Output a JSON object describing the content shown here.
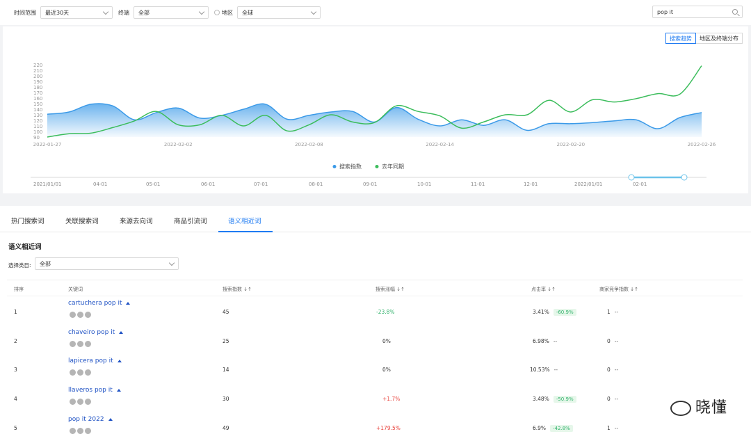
{
  "filters": {
    "time_label": "时间范围",
    "time_value": "最近30天",
    "terminal_label": "终端",
    "terminal_value": "全部",
    "region_label": "地区",
    "region_value": "全球",
    "search_value": "pop it"
  },
  "chart_toggle": {
    "active": "搜索趋势",
    "inactive": "地区及终端分布"
  },
  "chart_data": {
    "type": "area",
    "x": [
      "2022-01-27",
      "2022-01-28",
      "2022-01-29",
      "2022-01-30",
      "2022-01-31",
      "2022-02-01",
      "2022-02-02",
      "2022-02-03",
      "2022-02-04",
      "2022-02-05",
      "2022-02-06",
      "2022-02-07",
      "2022-02-08",
      "2022-02-09",
      "2022-02-10",
      "2022-02-11",
      "2022-02-12",
      "2022-02-13",
      "2022-02-14",
      "2022-02-15",
      "2022-02-16",
      "2022-02-17",
      "2022-02-18",
      "2022-02-19",
      "2022-02-20",
      "2022-02-21",
      "2022-02-22",
      "2022-02-23",
      "2022-02-24",
      "2022-02-25",
      "2022-02-26"
    ],
    "xticks": [
      "2022-01-27",
      "2022-02-02",
      "2022-02-08",
      "2022-02-14",
      "2022-02-20",
      "2022-02-26"
    ],
    "yticks": [
      90,
      100,
      110,
      120,
      130,
      140,
      150,
      160,
      170,
      180,
      190,
      200,
      210,
      220
    ],
    "ylim": [
      90,
      220
    ],
    "series": [
      {
        "name": "搜索指数",
        "color": "#3b9ae8",
        "values": [
          131,
          135,
          149,
          146,
          121,
          134,
          142,
          124,
          129,
          140,
          149,
          122,
          129,
          135,
          136,
          117,
          143,
          122,
          110,
          121,
          111,
          121,
          102,
          114,
          114,
          116,
          119,
          121,
          105,
          125,
          134
        ]
      },
      {
        "name": "去年同期",
        "color": "#3cbd5c",
        "values": [
          90,
          96,
          97,
          107,
          119,
          136,
          112,
          112,
          129,
          110,
          129,
          101,
          112,
          130,
          117,
          116,
          146,
          136,
          128,
          106,
          117,
          130,
          130,
          156,
          135,
          157,
          153,
          159,
          168,
          167,
          218
        ]
      }
    ],
    "timeline_labels": [
      "2021/01/01",
      "04-01",
      "05-01",
      "06-01",
      "07-01",
      "08-01",
      "09-01",
      "10-01",
      "11-01",
      "12-01",
      "2022/01/01",
      "02-01"
    ]
  },
  "tabs": [
    "热门搜索词",
    "关联搜索词",
    "来源去向词",
    "商品引流词",
    "语义相近词"
  ],
  "active_tab": "语义相近词",
  "section_title": "语义相近词",
  "category": {
    "label": "选择类目:",
    "value": "全部"
  },
  "table": {
    "headers": [
      "排序",
      "关键词",
      "搜索指数 ↓↑",
      "搜索涨幅 ↓↑",
      "点击率 ↓↑",
      "商家竞争指数 ↓↑"
    ],
    "rows": [
      {
        "rank": "1",
        "keyword": "cartuchera pop it",
        "index": "45",
        "growth": "-23.8%",
        "growth_type": "neg",
        "ctr": "3.41%",
        "ctr_badge": "-60.9%",
        "comp": "1",
        "comp_extra": "--"
      },
      {
        "rank": "2",
        "keyword": "chaveiro pop it",
        "index": "25",
        "growth": "0%",
        "growth_type": "neutral",
        "ctr": "6.98%",
        "ctr_badge": "",
        "comp": "0",
        "comp_extra": "--"
      },
      {
        "rank": "3",
        "keyword": "lapicera pop it",
        "index": "14",
        "growth": "0%",
        "growth_type": "neutral",
        "ctr": "10.53%",
        "ctr_badge": "",
        "comp": "0",
        "comp_extra": "--"
      },
      {
        "rank": "4",
        "keyword": "llaveros pop it",
        "index": "30",
        "growth": "+1.7%",
        "growth_type": "pos",
        "ctr": "3.48%",
        "ctr_badge": "-50.9%",
        "comp": "0",
        "comp_extra": "--"
      },
      {
        "rank": "5",
        "keyword": "pop it 2022",
        "index": "49",
        "growth": "+179.5%",
        "growth_type": "pos",
        "ctr": "6.9%",
        "ctr_badge": "-42.8%",
        "comp": "1",
        "comp_extra": "--"
      }
    ],
    "ctr_dash": "--"
  },
  "watermark": "晓懂"
}
